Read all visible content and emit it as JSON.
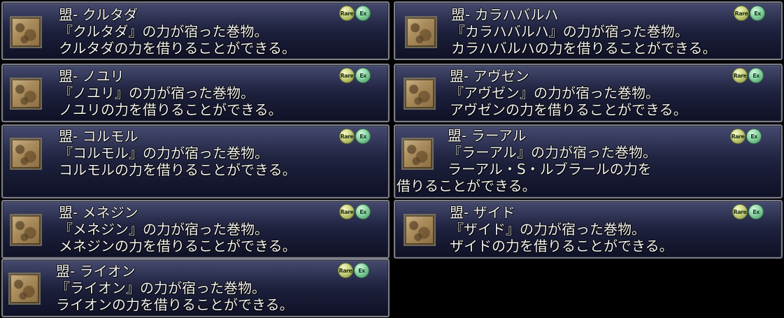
{
  "badges": {
    "rare_label": "Rare",
    "ex_label": "Ex"
  },
  "items": {
    "kurutada": {
      "name": "盟- クルタダ",
      "line1": "『クルタダ』の力が宿った巻物。",
      "line2": "クルタダの力を借りることができる。"
    },
    "karahabaruha": {
      "name": "盟- カラハバルハ",
      "line1": "『カラハバルハ』の力が宿った巻物。",
      "line2": "カラハバルハの力を借りることができる。"
    },
    "noyuri": {
      "name": "盟- ノユリ",
      "line1": "『ノユリ』の力が宿った巻物。",
      "line2": "ノユリの力を借りることができる。"
    },
    "auzen": {
      "name": "盟- アヴゼン",
      "line1": "『アヴゼン』の力が宿った巻物。",
      "line2": "アヴゼンの力を借りることができる。"
    },
    "korumoru": {
      "name": "盟- コルモル",
      "line1": "『コルモル』の力が宿った巻物。",
      "line2": "コルモルの力を借りることができる。"
    },
    "raaaru": {
      "name": "盟- ラーアル",
      "line1": "『ラーアル』の力が宿った巻物。",
      "line2": "ラーアル・S・ルブラールの力を",
      "line3": "借りることができる。"
    },
    "menejin": {
      "name": "盟- メネジン",
      "line1": "『メネジン』の力が宿った巻物。",
      "line2": "メネジンの力を借りることができる。"
    },
    "zaido": {
      "name": "盟- ザイド",
      "line1": "『ザイド』の力が宿った巻物。",
      "line2": "ザイドの力を借りることができる。"
    },
    "raion": {
      "name": "盟- ライオン",
      "line1": "『ライオン』の力が宿った巻物。",
      "line2": "ライオンの力を借りることができる。"
    }
  }
}
